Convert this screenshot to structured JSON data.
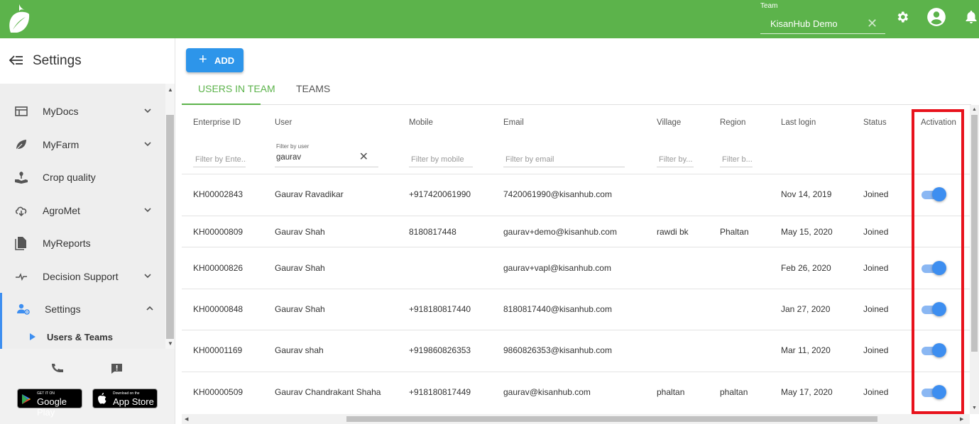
{
  "topbar": {
    "team_label": "Team",
    "team_value": "KisanHub Demo",
    "icons": [
      "leaf-logo",
      "gear-icon",
      "account-icon",
      "bell-icon"
    ],
    "brand_color": "#5cb34b"
  },
  "sidebar": {
    "title": "Settings",
    "items": [
      {
        "label": "MyDocs",
        "icon": "docs-icon",
        "expandable": true
      },
      {
        "label": "MyFarm",
        "icon": "leaf-icon",
        "expandable": true
      },
      {
        "label": "Crop quality",
        "icon": "plant-hand-icon",
        "expandable": false
      },
      {
        "label": "AgroMet",
        "icon": "cloud-icon",
        "expandable": true
      },
      {
        "label": "MyReports",
        "icon": "report-icon",
        "expandable": false
      },
      {
        "label": "Decision Support",
        "icon": "pulse-icon",
        "expandable": true
      },
      {
        "label": "Settings",
        "icon": "users-settings-icon",
        "expanded": true
      }
    ],
    "sub_item": "Users & Teams",
    "footer": {
      "google_small": "GET IT ON",
      "google_big": "Google Play",
      "apple_small": "Download on the",
      "apple_big": "App Store"
    }
  },
  "main": {
    "add_label": "ADD",
    "tabs": [
      {
        "label": "USERS IN TEAM",
        "active": true
      },
      {
        "label": "TEAMS",
        "active": false
      }
    ]
  },
  "grid": {
    "columns": [
      "Enterprise ID",
      "User",
      "Mobile",
      "Email",
      "Village",
      "Region",
      "Last login",
      "Status",
      "Activation"
    ],
    "filters": {
      "enterprise": "Filter by Ente...",
      "user_label": "Filter by user",
      "user_value": "gaurav",
      "mobile": "Filter by mobile",
      "email": "Filter by email",
      "village": "Filter by...",
      "region": "Filter b..."
    },
    "rows": [
      {
        "id": "KH00002843",
        "user": "Gaurav Ravadikar",
        "mobile": "+917420061990",
        "email": "7420061990@kisanhub.com",
        "village": "",
        "region": "",
        "last_login": "Nov 14, 2019",
        "status": "Joined",
        "active": true
      },
      {
        "id": "KH00000809",
        "user": "Gaurav Shah",
        "mobile": "8180817448",
        "email": "gaurav+demo@kisanhub.com",
        "village": "rawdi bk",
        "region": "Phaltan",
        "last_login": "May 15, 2020",
        "status": "Joined",
        "active": null
      },
      {
        "id": "KH00000826",
        "user": "Gaurav Shah",
        "mobile": "",
        "email": "gaurav+vapl@kisanhub.com",
        "village": "",
        "region": "",
        "last_login": "Feb 26, 2020",
        "status": "Joined",
        "active": true
      },
      {
        "id": "KH00000848",
        "user": "Gaurav Shah",
        "mobile": "+918180817440",
        "email": "8180817440@kisanhub.com",
        "village": "",
        "region": "",
        "last_login": "Jan 27, 2020",
        "status": "Joined",
        "active": true
      },
      {
        "id": "KH00001169",
        "user": "Gaurav shah",
        "mobile": "+919860826353",
        "email": "9860826353@kisanhub.com",
        "village": "",
        "region": "",
        "last_login": "Mar 11, 2020",
        "status": "Joined",
        "active": true
      },
      {
        "id": "KH00000509",
        "user": "Gaurav Chandrakant Shaha",
        "mobile": "+918180817449",
        "email": "gaurav@kisanhub.com",
        "village": "phaltan",
        "region": "phaltan",
        "last_login": "May 17, 2020",
        "status": "Joined",
        "active": true
      }
    ],
    "accent": "#3d8ef0",
    "highlight_color": "#e8121c"
  }
}
